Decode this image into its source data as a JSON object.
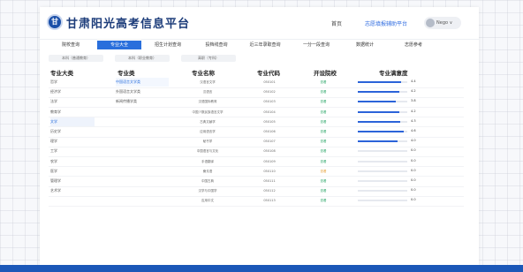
{
  "header": {
    "title": "甘肃阳光高考信息平台",
    "logo_text": "甘",
    "links": [
      "首页",
      "志愿填报辅助平台"
    ],
    "user": "Nego ∨"
  },
  "nav": {
    "items": [
      "院校查询",
      "专业大全",
      "招生计划查询",
      "投档线查询",
      "近三年录取查询",
      "一分一段查询",
      "数据统计",
      "志愿参考"
    ],
    "active_index": 1
  },
  "filters": [
    "本科（普通教育）",
    "本科（职业教育）",
    "高职（专科）"
  ],
  "columns": {
    "category": "专业大类",
    "subcategory": "专业类",
    "name": "专业名称",
    "code": "专业代码",
    "degree": "开设院校",
    "satisfaction": "专业满意度"
  },
  "categories": [
    "哲学",
    "经济学",
    "法学",
    "教育学",
    "文学",
    "历史学",
    "理学",
    "工学",
    "农学",
    "医学",
    "管理学",
    "艺术学"
  ],
  "categories_active": 4,
  "subcategories": [
    "中国语言文学类",
    "外国语言文学类",
    "新闻传播学类"
  ],
  "subcategories_active": 0,
  "rows": [
    {
      "name": "汉语言文学",
      "code": "050101",
      "deg": "查看",
      "score": 4.4
    },
    {
      "name": "汉语言",
      "code": "050102",
      "deg": "查看",
      "score": 4.2
    },
    {
      "name": "汉语国际教育",
      "code": "050103",
      "deg": "查看",
      "score": 3.8
    },
    {
      "name": "中国少数民族语言文学",
      "code": "050104",
      "deg": "查看",
      "score": 4.2
    },
    {
      "name": "古典文献学",
      "code": "050105",
      "deg": "查看",
      "score": 4.3
    },
    {
      "name": "应用语言学",
      "code": "050106",
      "deg": "查看",
      "score": 4.6
    },
    {
      "name": "秘书学",
      "code": "050107",
      "deg": "查看",
      "score": 4.0
    },
    {
      "name": "中国语言与文化",
      "code": "050108",
      "deg": "查看",
      "score": 0.0
    },
    {
      "name": "手语翻译",
      "code": "050109",
      "deg": "查看",
      "score": 0.0
    },
    {
      "name": "桑戈语",
      "code": "050110",
      "deg": "查看",
      "score": 0.0
    },
    {
      "name": "中国古典",
      "code": "050111",
      "deg": "查看",
      "score": 0.0
    },
    {
      "name": "汉学与中国学",
      "code": "050112",
      "deg": "查看",
      "score": 0.0
    },
    {
      "name": "应用中文",
      "code": "050113",
      "deg": "查看",
      "score": 0.0
    }
  ],
  "colors": {
    "accent": "#2a6fdc",
    "bar": "#2b63d9",
    "green": "#2ea86b",
    "bottom": "#1b57b8"
  }
}
